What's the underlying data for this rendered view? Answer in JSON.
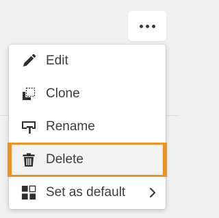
{
  "colors": {
    "page_background": "#f1f1f1",
    "menu_background": "#ffffff",
    "text": "#3c3c3c",
    "icon": "#2f2f2f",
    "focus_outline": "#f0921e"
  },
  "more_button": {
    "icon": "more-horizontal-icon"
  },
  "menu": {
    "items": [
      {
        "label": "Edit",
        "icon": "pencil-icon"
      },
      {
        "label": "Clone",
        "icon": "clone-icon"
      },
      {
        "label": "Rename",
        "icon": "rename-icon"
      },
      {
        "label": "Delete",
        "icon": "trash-icon",
        "focused": true
      },
      {
        "label": "Set as default",
        "icon": "set-default-icon",
        "has_submenu": true,
        "submenu_icon": "chevron-right-icon"
      }
    ]
  }
}
